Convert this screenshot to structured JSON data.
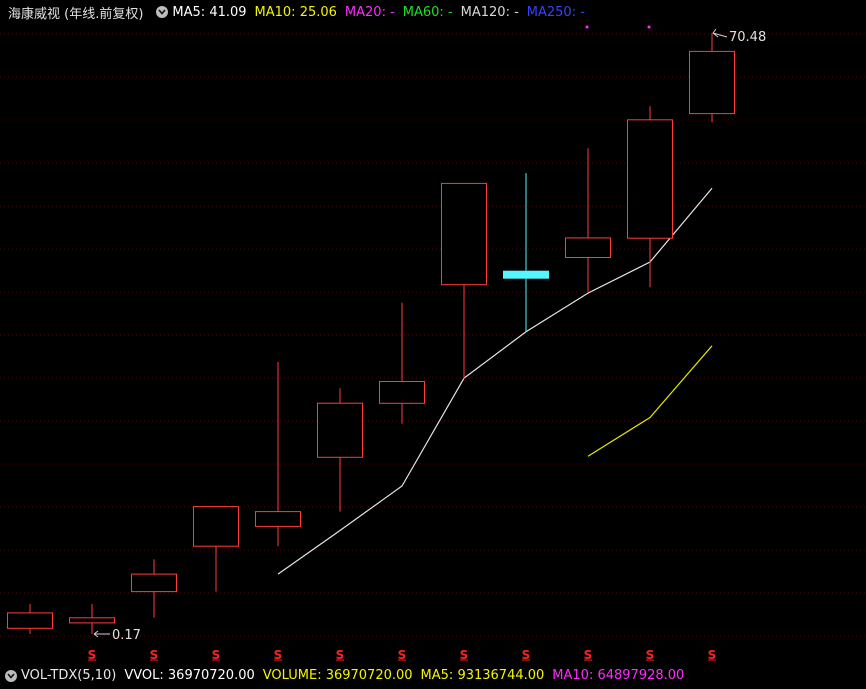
{
  "header": {
    "title": "海康威视 (年线.前复权)",
    "indicators": [
      {
        "label": "MA5: 41.09",
        "color": "#ffffff"
      },
      {
        "label": "MA10: 25.06",
        "color": "#f5f500"
      },
      {
        "label": "MA20: -",
        "color": "#ff2bff"
      },
      {
        "label": "MA60: -",
        "color": "#1ee01e"
      },
      {
        "label": "MA120: -",
        "color": "#d8d8d8"
      },
      {
        "label": "MA250: -",
        "color": "#3344ff"
      }
    ]
  },
  "footer": {
    "title": "VOL-TDX(5,10)",
    "vvol": "VVOL: 36970720.00",
    "volume": "VOLUME: 36970720.00",
    "ma5": "MA5: 93136744.00",
    "ma10": "MA10: 64897928.00"
  },
  "chart_data": {
    "type": "candlestick",
    "scale": "log",
    "candles": [
      {
        "open": 0.21,
        "close": 0.18,
        "high": 0.23,
        "low": 0.17,
        "dir": "down"
      },
      {
        "open": 0.2,
        "close": 0.19,
        "high": 0.23,
        "low": 0.17,
        "dir": "down"
      },
      {
        "open": 0.31,
        "close": 0.26,
        "high": 0.36,
        "low": 0.2,
        "dir": "down"
      },
      {
        "open": 0.61,
        "close": 0.41,
        "high": 0.61,
        "low": 0.26,
        "dir": "down"
      },
      {
        "open": 0.58,
        "close": 0.5,
        "high": 2.6,
        "low": 0.41,
        "dir": "down"
      },
      {
        "open": 1.72,
        "close": 1.0,
        "high": 2.0,
        "low": 0.58,
        "dir": "down"
      },
      {
        "open": 2.14,
        "close": 1.72,
        "high": 4.71,
        "low": 1.4,
        "dir": "down"
      },
      {
        "open": 15.6,
        "close": 5.65,
        "high": 15.6,
        "low": 2.2,
        "dir": "down"
      },
      {
        "open": 6.5,
        "close": 6.0,
        "high": 17.3,
        "low": 3.5,
        "dir": "up"
      },
      {
        "open": 9.03,
        "close": 7.42,
        "high": 22.2,
        "low": 5.2,
        "dir": "down"
      },
      {
        "open": 29.5,
        "close": 9.0,
        "high": 33.8,
        "low": 5.5,
        "dir": "down"
      },
      {
        "open": 58.6,
        "close": 31.4,
        "high": 70.48,
        "low": 28.8,
        "dir": "down"
      }
    ],
    "ma5": [
      null,
      null,
      null,
      null,
      0.31,
      0.48,
      0.75,
      2.21,
      3.52,
      5.19,
      7.09,
      14.87
    ],
    "ma10": [
      null,
      null,
      null,
      null,
      null,
      null,
      null,
      null,
      null,
      1.01,
      1.49,
      3.06
    ],
    "dividend_marker": "S",
    "annotations": {
      "max": "70.48",
      "min": "0.17"
    }
  }
}
